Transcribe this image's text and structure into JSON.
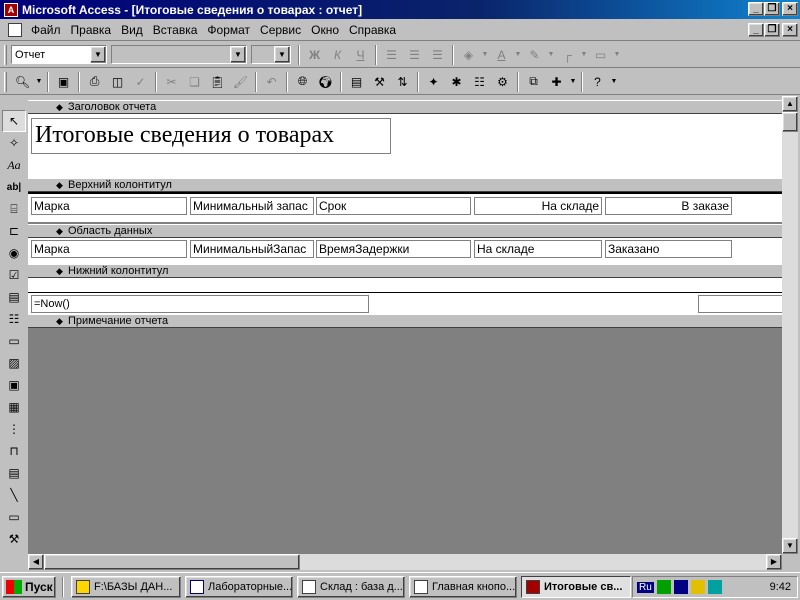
{
  "window": {
    "title": "Microsoft Access - [Итоговые сведения о товарах : отчет]",
    "minimize": "_",
    "restore": "❐",
    "close": "×"
  },
  "menu": [
    "Файл",
    "Правка",
    "Вид",
    "Вставка",
    "Формат",
    "Сервис",
    "Окно",
    "Справка"
  ],
  "format_toolbar": {
    "object_combo": "Отчет",
    "font_combo": "",
    "size_combo": "",
    "bold": "Ж",
    "italic": "К",
    "underline": "Ч"
  },
  "toolbox": [
    "select-objects",
    "control-wizards",
    "label",
    "text-box",
    "option-group",
    "toggle-button",
    "option-button",
    "check-box",
    "combo-box",
    "list-box",
    "command-button",
    "image",
    "unbound-object-frame",
    "bound-object-frame",
    "page-break",
    "tab-control",
    "subform",
    "line",
    "rectangle",
    "more-controls"
  ],
  "report": {
    "header_label": "Заголовок отчета",
    "title": "Итоговые сведения о товарах",
    "page_header_label": "Верхний колонтитул",
    "page_header_fields": [
      "Марка",
      "Минимальный запас",
      "Срок",
      "На складе",
      "В заказе"
    ],
    "detail_label": "Область данных",
    "detail_fields": [
      "Марка",
      "МинимальныйЗапас",
      "ВремяЗадержки",
      "На складе",
      "Заказано"
    ],
    "page_footer_label": "Нижний колонтитул",
    "footer_expr": "=Now()",
    "report_footer_label": "Примечание отчета"
  },
  "taskbar": {
    "start": "Пуск",
    "tasks": [
      "F:\\БАЗЫ ДАН...",
      "Лабораторные...",
      "Склад : база д...",
      "Главная кнопо...",
      "Итоговые св..."
    ],
    "active_task": 4,
    "lang": "Ru",
    "clock": "9:42"
  }
}
